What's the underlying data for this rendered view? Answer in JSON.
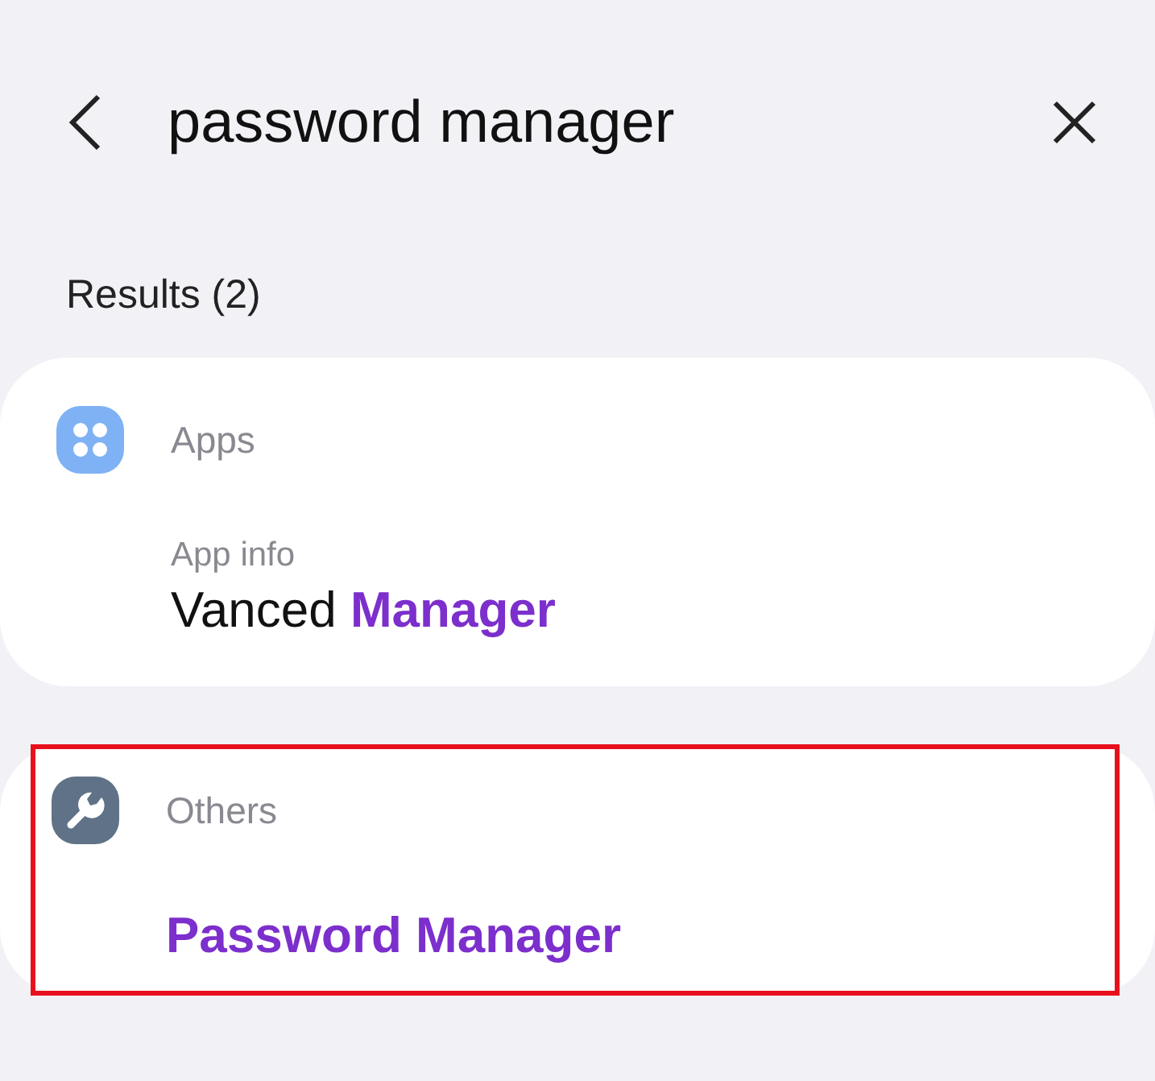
{
  "query": "password manager",
  "results_label": "Results (2)",
  "groups": [
    {
      "category": "Apps",
      "kind": "apps",
      "highlighted": false,
      "entries": [
        {
          "subtitle": "App info",
          "title": [
            {
              "text": "Vanced ",
              "match": false
            },
            {
              "text": "Manager",
              "match": true
            }
          ]
        }
      ]
    },
    {
      "category": "Others",
      "kind": "wrench",
      "highlighted": true,
      "entries": [
        {
          "title": [
            {
              "text": "Password Manager",
              "match": true
            }
          ]
        }
      ]
    }
  ]
}
